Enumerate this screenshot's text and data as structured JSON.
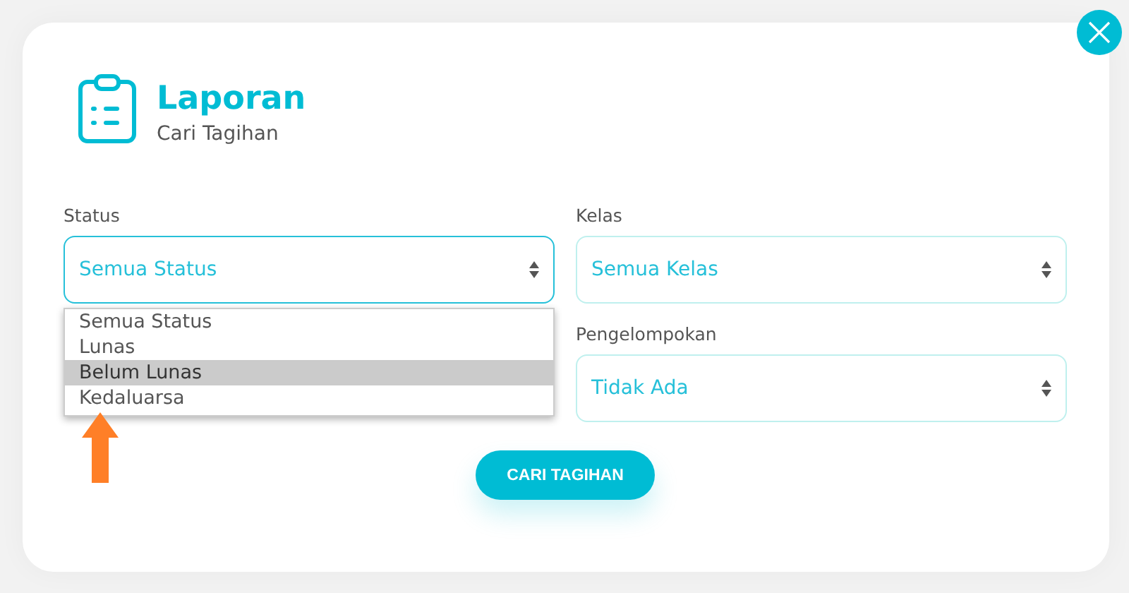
{
  "header": {
    "title": "Laporan",
    "subtitle": "Cari Tagihan"
  },
  "columns": [
    {
      "fields": [
        {
          "label": "Status",
          "value": "Semua Status",
          "focused": true
        }
      ]
    },
    {
      "fields": [
        {
          "label": "Kelas",
          "value": "Semua Kelas",
          "focused": false
        },
        {
          "label": "Pengelompokan",
          "value": "Tidak Ada",
          "focused": false
        }
      ]
    }
  ],
  "dropdown": {
    "options": [
      {
        "label": "Semua Status",
        "selected": false
      },
      {
        "label": "Lunas",
        "selected": false
      },
      {
        "label": "Belum Lunas",
        "selected": true
      },
      {
        "label": "Kedaluarsa",
        "selected": false
      }
    ]
  },
  "button": "CARI TAGIHAN"
}
